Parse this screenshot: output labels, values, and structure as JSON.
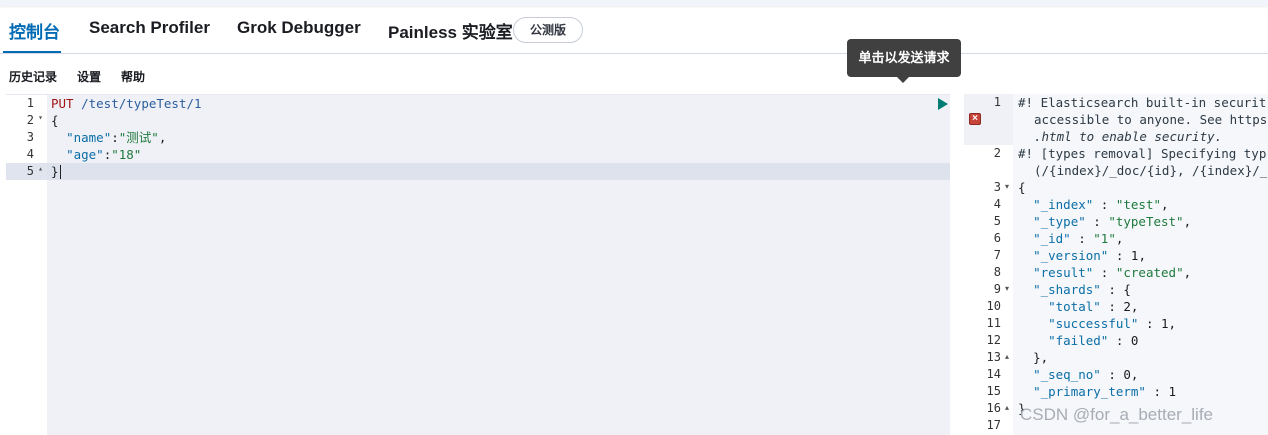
{
  "tabs": [
    {
      "label": "控制台",
      "active": true
    },
    {
      "label": "Search Profiler",
      "active": false
    },
    {
      "label": "Grok Debugger",
      "active": false
    },
    {
      "label": "Painless 实验室",
      "active": false
    }
  ],
  "beta_badge": "公测版",
  "tooltip": "单击以发送请求",
  "menu": [
    "历史记录",
    "设置",
    "帮助"
  ],
  "request": {
    "lines": [
      {
        "num": "1",
        "fold": ""
      },
      {
        "num": "2",
        "fold": "▾"
      },
      {
        "num": "3",
        "fold": ""
      },
      {
        "num": "4",
        "fold": ""
      },
      {
        "num": "5",
        "fold": "▴"
      }
    ],
    "method": "PUT",
    "path": "/test/typeTest/1",
    "open_brace": "{",
    "close_brace": "}",
    "name_key": "\"name\"",
    "name_value": "\"测试\"",
    "age_key": "\"age\"",
    "age_value": "\"18\""
  },
  "response": {
    "line_numbers": [
      "1",
      "2",
      "3",
      "4",
      "5",
      "6",
      "7",
      "8",
      "9",
      "10",
      "11",
      "12",
      "13",
      "14",
      "15",
      "16",
      "17"
    ],
    "comment1_a": "#! Elasticsearch built-in securit",
    "comment1_b": "accessible to anyone. See https",
    "comment1_c": ".html to enable security.",
    "comment2_a": "#! [types removal] Specifying typ",
    "comment2_b": "(/{index}/_doc/{id}, /{index}/_",
    "open_brace": "{",
    "index_key": "\"_index\"",
    "index_val": "\"test\"",
    "type_key": "\"_type\"",
    "type_val": "\"typeTest\"",
    "id_key": "\"_id\"",
    "id_val": "\"1\"",
    "version_key": "\"_version\"",
    "version_val": "1",
    "result_key": "\"result\"",
    "result_val": "\"created\"",
    "shards_key": "\"_shards\"",
    "total_key": "\"total\"",
    "total_val": "2",
    "successful_key": "\"successful\"",
    "successful_val": "1",
    "failed_key": "\"failed\"",
    "failed_val": "0",
    "shards_close": "},",
    "seq_key": "\"_seq_no\"",
    "seq_val": "0",
    "term_key": "\"_primary_term\"",
    "term_val": "1",
    "close_brace": "}"
  },
  "watermark": "CSDN @for_a_better_life",
  "colors": {
    "accent": "#006bb4",
    "run_icon": "#017d73",
    "error_icon": "#c6443a"
  },
  "icons": [
    "play-icon",
    "wrench-icon",
    "error-icon"
  ]
}
